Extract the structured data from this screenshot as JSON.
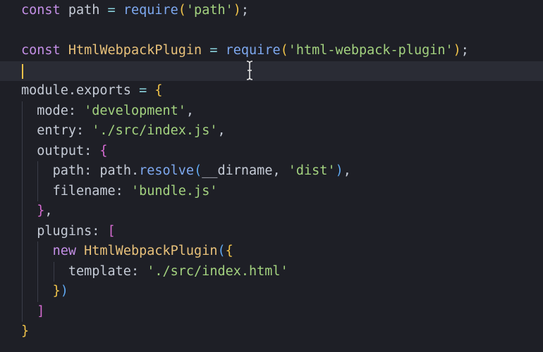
{
  "editor": {
    "language": "javascript",
    "current_line": 3,
    "lines": [
      [
        [
          "kw",
          "const"
        ],
        [
          "id",
          " path "
        ],
        [
          "op",
          "="
        ],
        [
          "id",
          " "
        ],
        [
          "fn",
          "require"
        ],
        [
          "b1",
          "("
        ],
        [
          "str",
          "'path'"
        ],
        [
          "b1",
          ")"
        ],
        [
          "punc",
          ";"
        ]
      ],
      [],
      [
        [
          "kw",
          "const"
        ],
        [
          "id",
          " "
        ],
        [
          "cls",
          "HtmlWebpackPlugin"
        ],
        [
          "id",
          " "
        ],
        [
          "op",
          "="
        ],
        [
          "id",
          " "
        ],
        [
          "fn",
          "require"
        ],
        [
          "b1",
          "("
        ],
        [
          "str",
          "'html-webpack-plugin'"
        ],
        [
          "b1",
          ")"
        ],
        [
          "punc",
          ";"
        ]
      ],
      [],
      [
        [
          "id",
          "module"
        ],
        [
          "punc",
          "."
        ],
        [
          "id",
          "exports "
        ],
        [
          "op",
          "="
        ],
        [
          "id",
          " "
        ],
        [
          "b1",
          "{"
        ]
      ],
      [
        [
          "id",
          "  "
        ],
        [
          "prop",
          "mode"
        ],
        [
          "punc",
          ": "
        ],
        [
          "str",
          "'development'"
        ],
        [
          "punc",
          ","
        ]
      ],
      [
        [
          "id",
          "  "
        ],
        [
          "prop",
          "entry"
        ],
        [
          "punc",
          ": "
        ],
        [
          "str",
          "'./src/index.js'"
        ],
        [
          "punc",
          ","
        ]
      ],
      [
        [
          "id",
          "  "
        ],
        [
          "prop",
          "output"
        ],
        [
          "punc",
          ": "
        ],
        [
          "b2",
          "{"
        ]
      ],
      [
        [
          "id",
          "    "
        ],
        [
          "prop",
          "path"
        ],
        [
          "punc",
          ": "
        ],
        [
          "id",
          "path"
        ],
        [
          "punc",
          "."
        ],
        [
          "fn",
          "resolve"
        ],
        [
          "b3",
          "("
        ],
        [
          "id",
          "__dirname"
        ],
        [
          "punc",
          ", "
        ],
        [
          "str",
          "'dist'"
        ],
        [
          "b3",
          ")"
        ],
        [
          "punc",
          ","
        ]
      ],
      [
        [
          "id",
          "    "
        ],
        [
          "prop",
          "filename"
        ],
        [
          "punc",
          ": "
        ],
        [
          "str",
          "'bundle.js'"
        ]
      ],
      [
        [
          "id",
          "  "
        ],
        [
          "b2",
          "}"
        ],
        [
          "punc",
          ","
        ]
      ],
      [
        [
          "id",
          "  "
        ],
        [
          "prop",
          "plugins"
        ],
        [
          "punc",
          ": "
        ],
        [
          "b2",
          "["
        ]
      ],
      [
        [
          "id",
          "    "
        ],
        [
          "kw",
          "new"
        ],
        [
          "id",
          " "
        ],
        [
          "cls",
          "HtmlWebpackPlugin"
        ],
        [
          "b3",
          "("
        ],
        [
          "b1",
          "{"
        ]
      ],
      [
        [
          "id",
          "      "
        ],
        [
          "prop",
          "template"
        ],
        [
          "punc",
          ": "
        ],
        [
          "str",
          "'./src/index.html'"
        ]
      ],
      [
        [
          "id",
          "    "
        ],
        [
          "b1",
          "}"
        ],
        [
          "b3",
          ")"
        ]
      ],
      [
        [
          "id",
          "  "
        ],
        [
          "b2",
          "]"
        ]
      ],
      [
        [
          "b1",
          "}"
        ]
      ]
    ]
  },
  "colors": {
    "background": "#1e1f26",
    "current_line": "#2a2c35",
    "keyword": "#c48fe6",
    "class": "#e8c17a",
    "function": "#7ea9f0",
    "string": "#a3d27f",
    "bracket_1": "#f0c34a",
    "bracket_2": "#d66bd1",
    "bracket_3": "#5fa8f0"
  },
  "icons": {
    "cursor": "text-ibeam-icon"
  }
}
